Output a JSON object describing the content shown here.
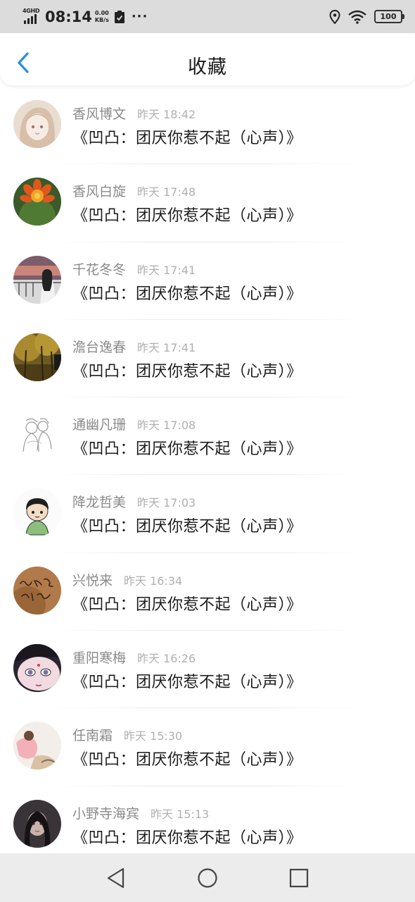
{
  "status_bar": {
    "network": "4GHD",
    "time": "08:14",
    "speed_value": "0.00",
    "speed_unit": "KB/s",
    "battery": "100",
    "icons": [
      "signal-icon",
      "clipboard-check-icon",
      "more-dots-icon",
      "location-icon",
      "wifi-icon",
      "battery-icon"
    ]
  },
  "header": {
    "title": "收藏",
    "back_icon": "chevron-left-icon",
    "accent_color": "#2a8fe0"
  },
  "favorites": [
    {
      "user": "香风博文",
      "time": "昨天 18:42",
      "content": "《凹凸：团厌你惹不起（心声）》",
      "avatar": "anime-girl-sketch"
    },
    {
      "user": "香风白旋",
      "time": "昨天 17:48",
      "content": "《凹凸：团厌你惹不起（心声）》",
      "avatar": "orange-cactus-flower"
    },
    {
      "user": "千花冬冬",
      "time": "昨天 17:41",
      "content": "《凹凸：团厌你惹不起（心声）》",
      "avatar": "girl-sunset-railing"
    },
    {
      "user": "澹台逸春",
      "time": "昨天 17:41",
      "content": "《凹凸：团厌你惹不起（心声）》",
      "avatar": "autumn-forest"
    },
    {
      "user": "通幽凡珊",
      "time": "昨天 17:08",
      "content": "《凹凸：团厌你惹不起（心声）》",
      "avatar": "sketch-couple"
    },
    {
      "user": "降龙哲美",
      "time": "昨天 17:03",
      "content": "《凹凸：团厌你惹不起（心声）》",
      "avatar": "cartoon-boy"
    },
    {
      "user": "兴悦来",
      "time": "昨天 16:34",
      "content": "《凹凸：团厌你惹不起（心声）》",
      "avatar": "handwriting-brown"
    },
    {
      "user": "重阳寒梅",
      "time": "昨天 16:26",
      "content": "《凹凸：团厌你惹不起（心声）》",
      "avatar": "anime-eyes-pink"
    },
    {
      "user": "任南霜",
      "time": "昨天 15:30",
      "content": "《凹凸：团厌你惹不起（心声）》",
      "avatar": "pink-dress-girl"
    },
    {
      "user": "小野寺海宾",
      "time": "昨天 15:13",
      "content": "《凹凸：团厌你惹不起（心声）》",
      "avatar": "dark-portrait"
    }
  ],
  "nav_bar": {
    "buttons": [
      "back-triangle-icon",
      "home-circle-icon",
      "recents-square-icon"
    ]
  }
}
